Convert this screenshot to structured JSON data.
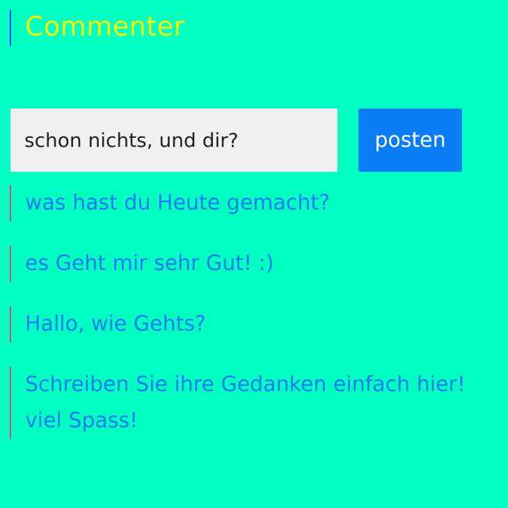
{
  "app": {
    "title": "Commenter"
  },
  "composer": {
    "input_value": "schon nichts, und dir?",
    "post_label": "posten"
  },
  "comments": [
    {
      "text": "was hast du Heute gemacht?"
    },
    {
      "text": "es Geht mir sehr Gut! :)"
    },
    {
      "text": "Hallo, wie Gehts?"
    },
    {
      "text": "Schreiben Sie ihre Gedanken einfach hier! viel Spass!"
    }
  ],
  "colors": {
    "background": "#00FFC0",
    "title": "#F2FF00",
    "button": "#0A7EF5",
    "comment_text": "#1A7BF2",
    "comment_border": "#D24B7A",
    "header_border": "#3A3AFF"
  }
}
